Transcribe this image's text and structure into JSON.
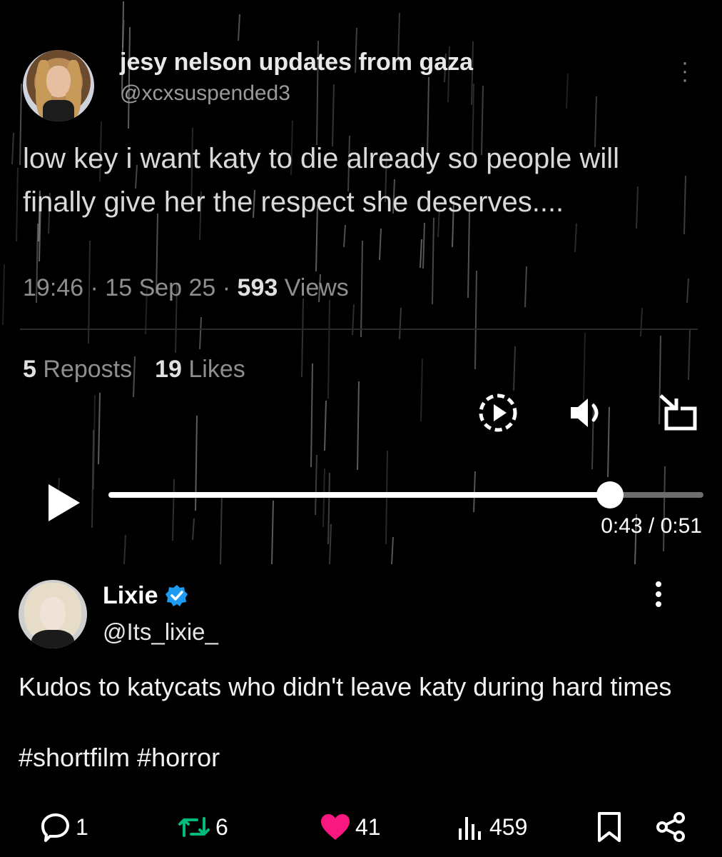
{
  "embedded_post": {
    "display_name": "jesy nelson updates from gaza",
    "handle": "@xcxsuspended3",
    "text": "low key i want katy to die already so people will finally give her the respect she deserves....",
    "timestamp": "19:46 · 15 Sep 25 · ",
    "views_count": "593",
    "views_label": " Views",
    "reposts_count": "5",
    "reposts_label": " Reposts",
    "likes_count": "19",
    "likes_label": " Likes"
  },
  "player": {
    "time_readout": "0:43 / 0:51",
    "progress_fraction": 0.843
  },
  "post": {
    "display_name": "Lixie",
    "handle": "@Its_lixie_",
    "text": "Kudos to katycats who didn't leave katy during hard times",
    "hashtags": [
      "#shortfilm",
      "#horror"
    ],
    "verified_color": "#1d9bf0"
  },
  "actions": {
    "replies": "1",
    "reposts": "6",
    "likes": "41",
    "views": "459",
    "repost_color": "#00ba7c",
    "like_color": "#f91880"
  },
  "icons": [
    "more-icon",
    "replay-icon",
    "volume-icon",
    "exit-fullscreen-icon",
    "play-icon",
    "verified-badge-icon",
    "reply-icon",
    "repost-icon",
    "heart-icon",
    "views-icon",
    "bookmark-icon",
    "share-icon"
  ]
}
